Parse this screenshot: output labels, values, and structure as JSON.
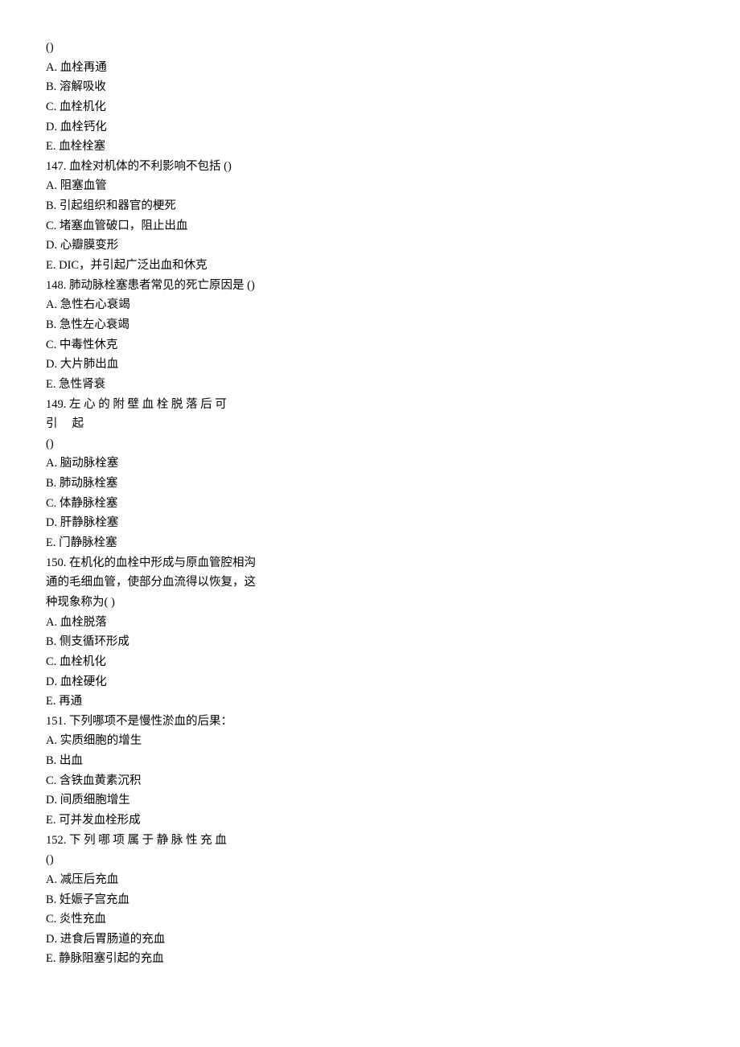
{
  "intro": {
    "paren": "()"
  },
  "q146_opts": {
    "A": "A.   血栓再通",
    "B": "B.   溶解吸收",
    "C": "C.   血栓机化",
    "D": "D.   血栓钙化",
    "E": "E.   血栓栓塞"
  },
  "q147": {
    "stem": "147.   血栓对机体的不利影响不包括  ()",
    "A": "A.   阻塞血管",
    "B": "B.   引起组织和器官的梗死",
    "C": "C.   堵塞血管破口，阻止出血",
    "D": "D.   心瓣膜变形",
    "E": "E.   DIC，并引起广泛出血和休克"
  },
  "q148": {
    "stem": "148.   肺动脉栓塞患者常见的死亡原因是  ()",
    "A": "A.   急性右心衰竭",
    "B": "B.   急性左心衰竭",
    "C": "C.   中毒性休克",
    "D": "D.   大片肺出血",
    "E": "E.   急性肾衰"
  },
  "q149": {
    "stem1": "149.  左 心 的 附 壁 血 栓 脱 落 后 可",
    "stem2": "引 起",
    "paren": "()",
    "A": "A.   脑动脉栓塞",
    "B": "B.   肺动脉栓塞",
    "C": "C.   体静脉栓塞",
    "D": "D.   肝静脉栓塞",
    "E": "E.   门静脉栓塞"
  },
  "q150": {
    "stem1": "150.   在机化的血栓中形成与原血管腔相沟",
    "stem2": "通的毛细血管，使部分血流得以恢复，这",
    "stem3": "种现象称为(                  )",
    "A": "A.   血栓脱落",
    "B": "B.   侧支循环形成",
    "C": "C.   血栓机化",
    "D": "D.   血栓硬化",
    "E": "E.   再通"
  },
  "q151": {
    "stem": "151.   下列哪项不是慢性淤血的后果：",
    "A": "A.   实质细胞的增生",
    "B": "B.   出血",
    "C": "C.   含铁血黄素沉积",
    "D": "D.   间质细胞增生",
    "E": "E.   可并发血栓形成"
  },
  "q152": {
    "stem1": "152.  下 列 哪 项 属 于 静 脉 性 充 血",
    "paren": "()",
    "A": "A.   减压后充血",
    "B": "B.   妊娠子宫充血",
    "C": "C.   炎性充血",
    "D": "D.   进食后胃肠道的充血",
    "E": "E.   静脉阻塞引起的充血"
  }
}
